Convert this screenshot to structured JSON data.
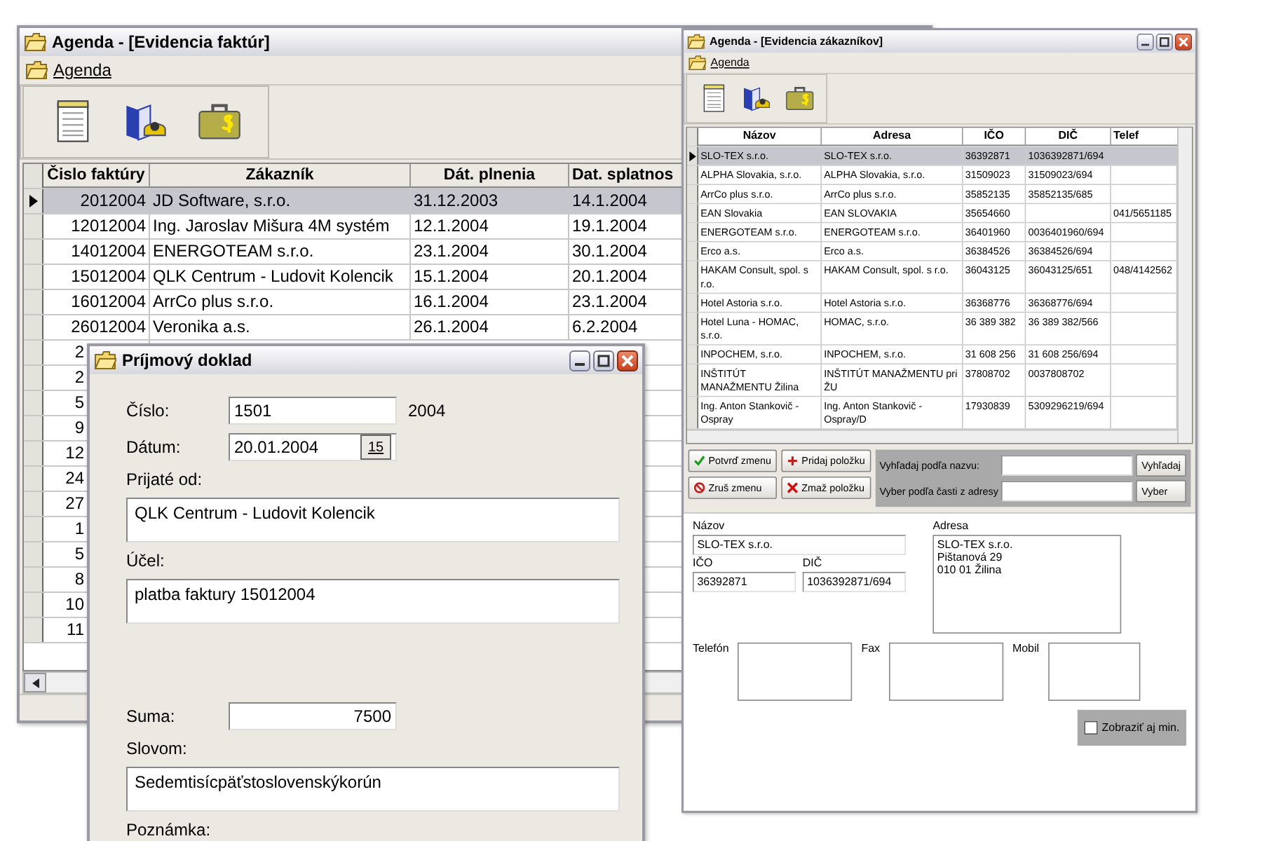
{
  "invoices_window": {
    "title": "Agenda - [Evidencia faktúr]",
    "menu": [
      "Agenda"
    ],
    "table": {
      "columns": [
        "Čislo faktúry",
        "Zákazník",
        "Dát. plnenia",
        "Dat. splatnos"
      ],
      "rows": [
        {
          "kind": "full",
          "selected": true,
          "cells": [
            "2012004",
            "JD Software, s.r.o.",
            "31.12.2003",
            "14.1.2004"
          ]
        },
        {
          "kind": "full",
          "selected": false,
          "cells": [
            "12012004",
            "Ing. Jaroslav Mišura 4M systém",
            "12.1.2004",
            "19.1.2004"
          ]
        },
        {
          "kind": "full",
          "selected": false,
          "cells": [
            "14012004",
            "ENERGOTEAM s.r.o.",
            "23.1.2004",
            "30.1.2004"
          ]
        },
        {
          "kind": "full",
          "selected": false,
          "cells": [
            "15012004",
            "QLK Centrum - Ludovit Kolencik",
            "15.1.2004",
            "20.1.2004"
          ]
        },
        {
          "kind": "full",
          "selected": false,
          "cells": [
            "16012004",
            "ArrCo plus s.r.o.",
            "16.1.2004",
            "23.1.2004"
          ]
        },
        {
          "kind": "full",
          "selected": false,
          "cells": [
            "26012004",
            "Veronika a.s.",
            "26.1.2004",
            "6.2.2004"
          ]
        },
        {
          "kind": "covered",
          "selected": false,
          "cells": [
            "2"
          ]
        },
        {
          "kind": "covered",
          "selected": false,
          "cells": [
            "2"
          ]
        },
        {
          "kind": "covered",
          "selected": false,
          "cells": [
            "5"
          ]
        },
        {
          "kind": "covered",
          "selected": false,
          "cells": [
            "9"
          ]
        },
        {
          "kind": "covered",
          "selected": false,
          "cells": [
            "12"
          ]
        },
        {
          "kind": "covered",
          "selected": false,
          "cells": [
            "24"
          ]
        },
        {
          "kind": "covered",
          "selected": false,
          "cells": [
            "27"
          ]
        },
        {
          "kind": "covered",
          "selected": false,
          "cells": [
            "1"
          ]
        },
        {
          "kind": "covered",
          "selected": false,
          "cells": [
            "5"
          ]
        },
        {
          "kind": "covered",
          "selected": false,
          "cells": [
            "8"
          ]
        },
        {
          "kind": "covered",
          "selected": false,
          "cells": [
            "10"
          ]
        },
        {
          "kind": "covered",
          "selected": false,
          "cells": [
            "11"
          ]
        }
      ]
    }
  },
  "receipt_dialog": {
    "title": "Príjmový doklad",
    "number": {
      "label": "Číslo:",
      "value": "1501",
      "suffix": "2004"
    },
    "date": {
      "label": "Dátum:",
      "value": "20.01.2004",
      "button": "15"
    },
    "received_from": {
      "label": "Prijaté od:",
      "value": "QLK Centrum - Ludovit Kolencik"
    },
    "purpose": {
      "label": "Účel:",
      "value": "platba faktury 15012004"
    },
    "amount": {
      "label": "Suma:",
      "value": "7500"
    },
    "in_words": {
      "label": "Slovom:",
      "value": "Sedemtisícpäťstoslovenskýkorún"
    },
    "note": {
      "label": "Poznámka:"
    }
  },
  "customers_window": {
    "title": "Agenda - [Evidencia zákazníkov]",
    "menu": [
      "Agenda"
    ],
    "table": {
      "columns": [
        "Názov",
        "Adresa",
        "IČO",
        "DIČ",
        "Telef"
      ],
      "rows": [
        {
          "selected": true,
          "cells": [
            "SLO-TEX s.r.o.",
            "SLO-TEX s.r.o.",
            "36392871",
            "1036392871/694",
            ""
          ]
        },
        {
          "selected": false,
          "cells": [
            "ALPHA Slovakia, s.r.o.",
            "ALPHA Slovakia, s.r.o.",
            "31509023",
            "31509023/694",
            ""
          ]
        },
        {
          "selected": false,
          "cells": [
            "ArrCo plus s.r.o.",
            "ArrCo plus s.r.o.",
            "35852135",
            "35852135/685",
            ""
          ]
        },
        {
          "selected": false,
          "cells": [
            "EAN Slovakia",
            "EAN SLOVAKIA",
            "35654660",
            "",
            "041/5651185"
          ]
        },
        {
          "selected": false,
          "cells": [
            "ENERGOTEAM s.r.o.",
            "ENERGOTEAM s.r.o.",
            "36401960",
            "0036401960/694",
            ""
          ]
        },
        {
          "selected": false,
          "cells": [
            "Erco a.s.",
            "Erco a.s.",
            "36384526",
            "36384526/694",
            ""
          ]
        },
        {
          "selected": false,
          "cells": [
            "HAKAM Consult, spol. s r.o.",
            "HAKAM Consult, spol. s r.o.",
            "36043125",
            "36043125/651",
            "048/4142562"
          ]
        },
        {
          "selected": false,
          "cells": [
            "Hotel Astoria s.r.o.",
            "Hotel Astoria s.r.o.",
            "36368776",
            "36368776/694",
            ""
          ]
        },
        {
          "selected": false,
          "cells": [
            "Hotel Luna - HOMAC, s.r.o.",
            "HOMAC, s.r.o.",
            "36 389 382",
            "36 389 382/566",
            ""
          ]
        },
        {
          "selected": false,
          "cells": [
            "INPOCHEM, s.r.o.",
            "INPOCHEM, s.r.o.",
            "31 608 256",
            "31 608 256/694",
            ""
          ]
        },
        {
          "selected": false,
          "cells": [
            "INŠTITÚT MANAŽMENTU Žilina",
            "INŠTITÚT MANAŽMENTU pri ŽU",
            "37808702",
            "0037808702",
            ""
          ]
        },
        {
          "selected": false,
          "cells": [
            "Ing. Anton Stankovič - Ospray",
            "Ing. Anton Stankovič - Ospray/D",
            "17930839",
            "5309296219/694",
            ""
          ]
        }
      ]
    },
    "buttons": [
      {
        "kind": "confirm",
        "label": "Potvrď zmenu"
      },
      {
        "kind": "add",
        "label": "Pridaj položku"
      },
      {
        "kind": "cancel",
        "label": "Zruš zmenu"
      },
      {
        "kind": "delete",
        "label": "Zmaž položku"
      }
    ],
    "search": {
      "by_name_label": "Vyhľadaj podľa nazvu:",
      "by_address_label": "Vyber podľa časti z adresy",
      "search_button": "Vyhľadaj",
      "select_button": "Vyber"
    },
    "form": {
      "name": {
        "label": "Názov",
        "value": "SLO-TEX s.r.o."
      },
      "ico": {
        "label": "IČO",
        "value": "36392871"
      },
      "dic": {
        "label": "DIČ",
        "value": "1036392871/694"
      },
      "address": {
        "label": "Adresa",
        "lines": [
          "SLO-TEX s.r.o.",
          "Pištanová 29",
          "010 01 Žilina"
        ]
      },
      "phone": {
        "label": "Telefón"
      },
      "fax": {
        "label": "Fax"
      },
      "mobile": {
        "label": "Mobil"
      },
      "show_min": {
        "label": "Zobraziť aj min.",
        "checked": false
      }
    }
  }
}
